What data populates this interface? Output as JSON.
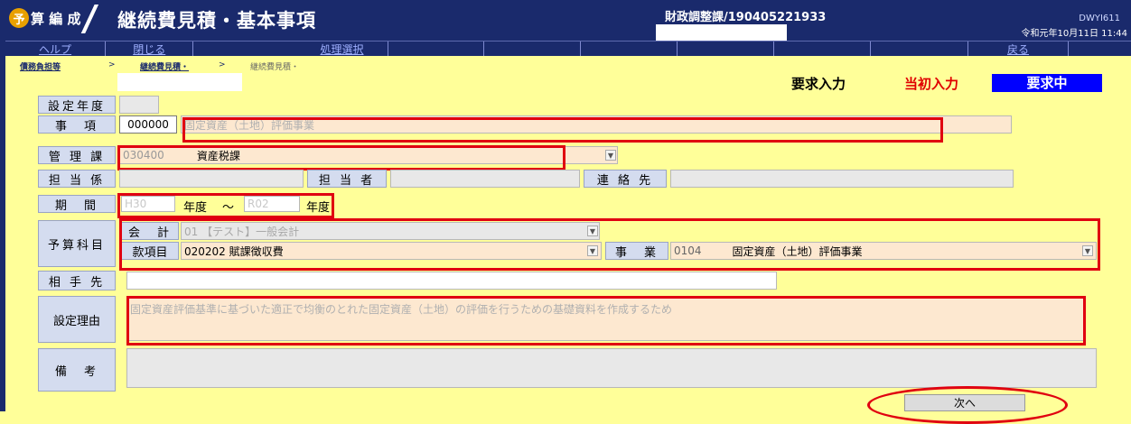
{
  "header": {
    "logo_mark": "予",
    "logo_text": "算 編 成",
    "title": "継続費見積・基本事項",
    "department": "財政調整課/190405221933",
    "screen_id": "DWYI611",
    "datetime": "令和元年10月11日 11:44"
  },
  "menu": {
    "help": "ヘルプ",
    "close": "閉じる",
    "process_select": "処理選択",
    "back": "戻る"
  },
  "breadcrumb": {
    "item1": "債務負担等",
    "sep": ">",
    "item2": "継続費見積・",
    "item3": "継続費見積・"
  },
  "status": {
    "request_input": "要求入力",
    "initial_input": "当初入力",
    "badge": "要求中"
  },
  "form": {
    "setting_year_label": "設定年度",
    "item_label": "事　項",
    "item_code": "000000",
    "item_name": "固定資産（土地）評価事業",
    "dept_label": "管 理 課",
    "dept_code": "030400",
    "dept_name": "資産税課",
    "staff_section_label": "担 当 係",
    "person_label": "担 当 者",
    "contact_label": "連 絡 先",
    "period_label": "期　間",
    "period_from": "H30",
    "year_unit": "年度",
    "tilde": "～",
    "period_to": "R02",
    "budget_label": "予算科目",
    "account_label": "会　計",
    "account_value": "01 【テスト】一般会計",
    "kanko_label": "款項目",
    "kanko_value": "020202 賦課徴収費",
    "jigyo_label": "事　業",
    "jigyo_code": "0104",
    "jigyo_name": "固定資産（土地）評価事業",
    "partner_label": "相 手 先",
    "reason_label": "設定理由",
    "reason_text": "固定資産評価基準に基づいた適正で均衡のとれた固定資産（土地）の評価を行うための基礎資料を作成するため",
    "remarks_label": "備　考"
  },
  "buttons": {
    "next": "次へ"
  },
  "colors": {
    "header_bg": "#1a2a6c",
    "page_bg": "#ffff99",
    "highlight_red": "#e00010",
    "badge_blue": "#0000ff"
  }
}
